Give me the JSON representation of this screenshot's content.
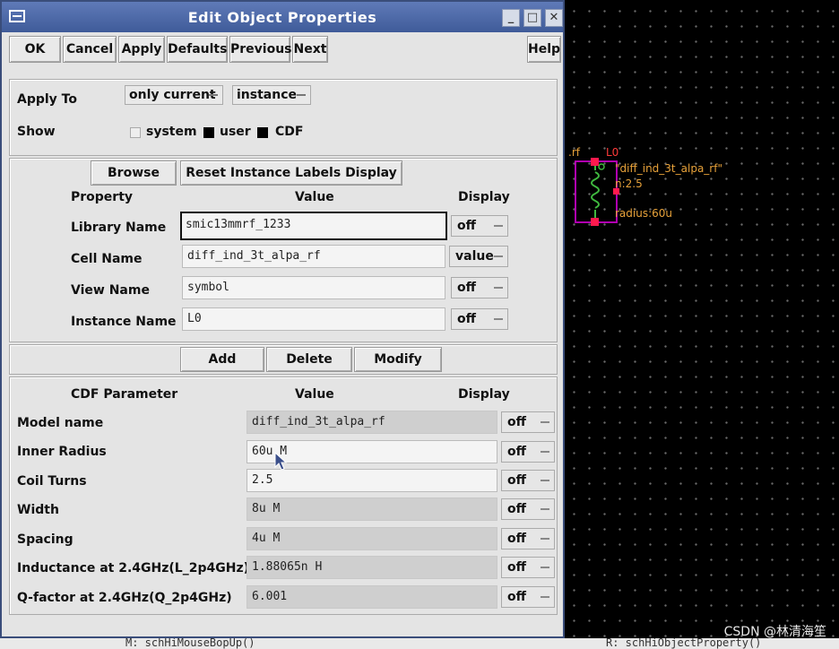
{
  "window": {
    "title": "Edit Object Properties"
  },
  "toolbar": {
    "ok": "OK",
    "cancel": "Cancel",
    "apply": "Apply",
    "defaults": "Defaults",
    "previous": "Previous",
    "next": "Next",
    "help": "Help"
  },
  "apply_to": {
    "label": "Apply To",
    "scope": "only current",
    "target": "instance"
  },
  "show": {
    "label": "Show",
    "options": [
      {
        "label": "system",
        "checked": false
      },
      {
        "label": "user",
        "checked": true
      },
      {
        "label": "CDF",
        "checked": true
      }
    ]
  },
  "properties": {
    "browse": "Browse",
    "reset": "Reset Instance Labels Display",
    "headers": {
      "property": "Property",
      "value": "Value",
      "display": "Display"
    },
    "rows": [
      {
        "name": "Library Name",
        "value": "smic13mmrf_1233",
        "display": "off"
      },
      {
        "name": "Cell Name",
        "value": "diff_ind_3t_alpa_rf",
        "display": "value"
      },
      {
        "name": "View Name",
        "value": "symbol",
        "display": "off"
      },
      {
        "name": "Instance Name",
        "value": "L0",
        "display": "off"
      }
    ]
  },
  "actions": {
    "add": "Add",
    "delete": "Delete",
    "modify": "Modify"
  },
  "cdf": {
    "headers": {
      "parameter": "CDF Parameter",
      "value": "Value",
      "display": "Display"
    },
    "rows": [
      {
        "name": "Model name",
        "value": "diff_ind_3t_alpa_rf",
        "display": "off"
      },
      {
        "name": "Inner Radius",
        "value": "60u M",
        "display": "off"
      },
      {
        "name": "Coil Turns",
        "value": "2.5",
        "display": "off"
      },
      {
        "name": "Width",
        "value": "8u M",
        "display": "off"
      },
      {
        "name": "Spacing",
        "value": "4u M",
        "display": "off"
      },
      {
        "name": "Inductance at 2.4GHz(L_2p4GHz)",
        "value": "1.88065n H",
        "display": "off"
      },
      {
        "name": "Q-factor at 2.4GHz(Q_2p4GHz)",
        "value": "6.001",
        "display": "off"
      }
    ]
  },
  "schematic": {
    "pin_label": ".rf",
    "instance_label": "L0",
    "cell_label": "\"diff_ind_3t_alpa_rf\"",
    "turns_label": "n:2.5",
    "radius_label": "radius:60u"
  },
  "status": {
    "left": "M: schHiMouseBopUp()",
    "right": "R: schHiObjectProperty()"
  },
  "watermark": "CSDN @林清海笙",
  "colors": {
    "titlebar": "#4a66a6",
    "schematic_text": "#e8a23a",
    "selection": "#ff1a4d",
    "instance_box": "#b000b0"
  }
}
